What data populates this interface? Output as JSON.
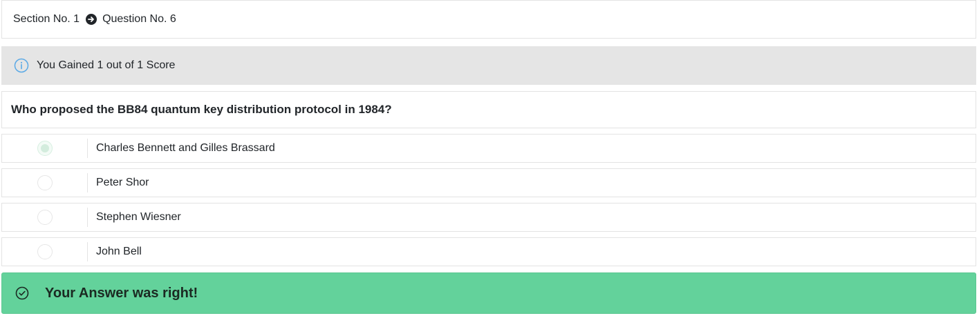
{
  "breadcrumb": {
    "section": "Section No. 1",
    "separator_icon": "arrow-circle-right-icon",
    "question": "Question No. 6"
  },
  "score": {
    "icon": "info-circle-icon",
    "text": "You Gained 1 out of 1 Score",
    "icon_color": "#5aa9e6"
  },
  "question": {
    "text": "Who proposed the BB84 quantum key distribution protocol in 1984?"
  },
  "options": [
    {
      "label": "Charles Bennett and Gilles Brassard",
      "selected": true
    },
    {
      "label": "Peter Shor",
      "selected": false
    },
    {
      "label": "Stephen Wiesner",
      "selected": false
    },
    {
      "label": "John Bell",
      "selected": false
    }
  ],
  "result": {
    "icon": "check-circle-icon",
    "text": "Your Answer was right!",
    "background": "#63d29b"
  }
}
